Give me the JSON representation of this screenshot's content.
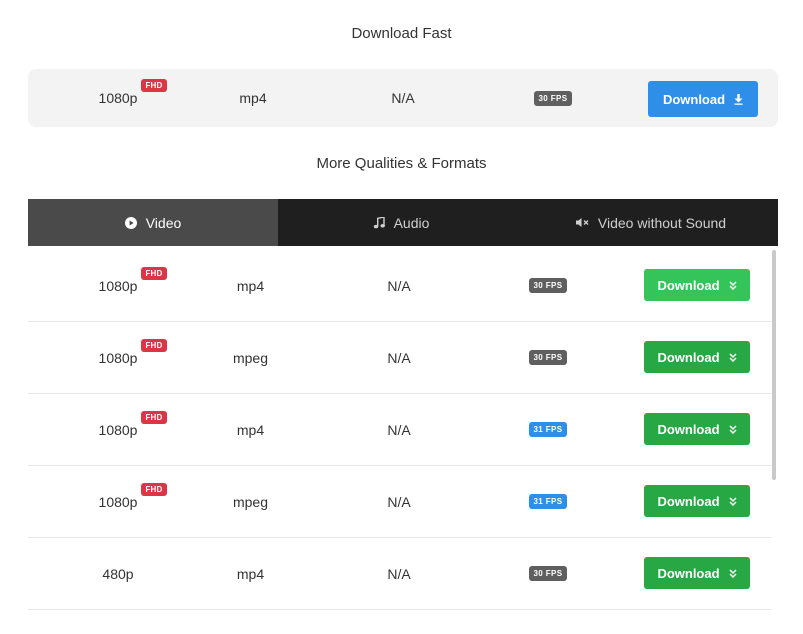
{
  "download_fast": {
    "title": "Download Fast",
    "quality": "1080p",
    "badge": "FHD",
    "format": "mp4",
    "size": "N/A",
    "fps": "30 FPS",
    "button_label": "Download"
  },
  "more": {
    "title": "More Qualities & Formats",
    "tabs": [
      {
        "label": "Video",
        "icon": "play-circle-icon",
        "active": true
      },
      {
        "label": "Audio",
        "icon": "music-note-icon",
        "active": false
      },
      {
        "label": "Video without Sound",
        "icon": "mute-icon",
        "active": false
      }
    ],
    "rows": [
      {
        "quality": "1080p",
        "badge": "FHD",
        "format": "mp4",
        "size": "N/A",
        "fps": "30 FPS",
        "fps_color": "#5f5f5f",
        "button": "Download"
      },
      {
        "quality": "1080p",
        "badge": "FHD",
        "format": "mpeg",
        "size": "N/A",
        "fps": "30 FPS",
        "fps_color": "#5f5f5f",
        "button": "Download"
      },
      {
        "quality": "1080p",
        "badge": "FHD",
        "format": "mp4",
        "size": "N/A",
        "fps": "31 FPS",
        "fps_color": "#2f8fe8",
        "button": "Download"
      },
      {
        "quality": "1080p",
        "badge": "FHD",
        "format": "mpeg",
        "size": "N/A",
        "fps": "31 FPS",
        "fps_color": "#2f8fe8",
        "button": "Download"
      },
      {
        "quality": "480p",
        "badge": "",
        "format": "mp4",
        "size": "N/A",
        "fps": "30 FPS",
        "fps_color": "#5f5f5f",
        "button": "Download"
      }
    ]
  },
  "colors": {
    "primary_blue": "#2f8fe8",
    "success_green": "#28a745",
    "badge_red": "#dc3545",
    "tab_bar": "#1f1f1f",
    "tab_active": "#4a4a4a"
  }
}
